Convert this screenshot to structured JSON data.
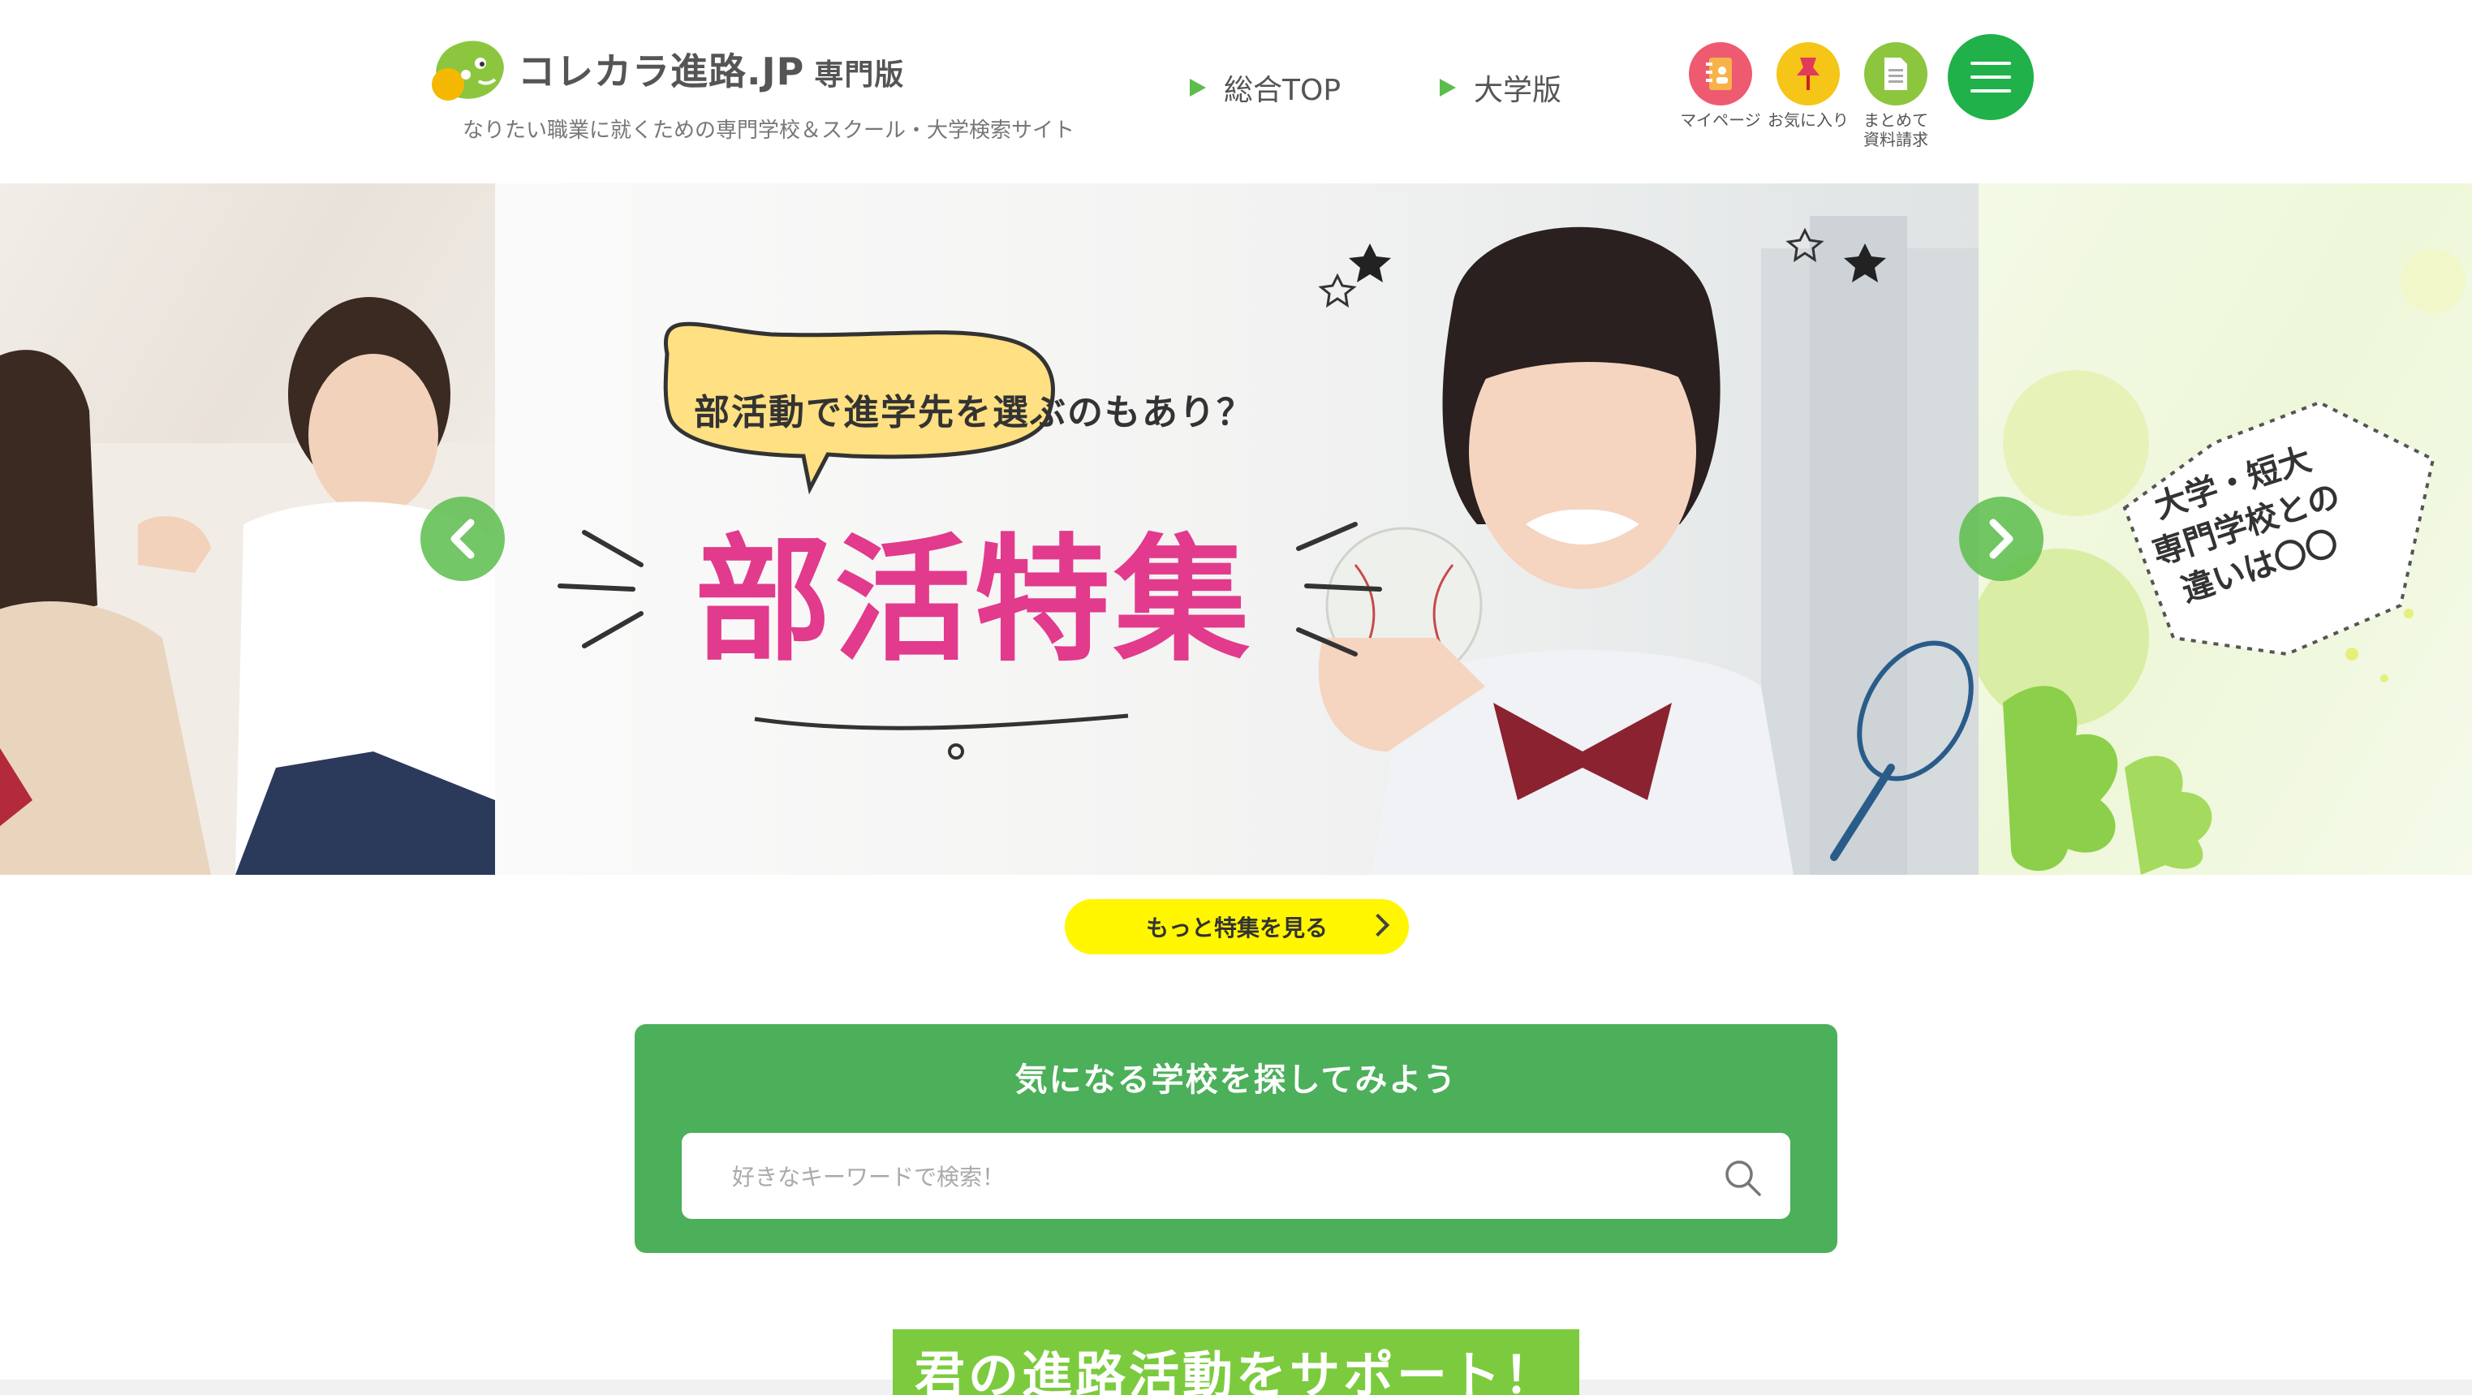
{
  "header": {
    "logo_main": "コレカラ進路.JP",
    "logo_sub": "専門版",
    "tagline": "なりたい職業に就くための専門学校＆スクール・大学検索サイト",
    "nav": [
      {
        "label": "総合TOP"
      },
      {
        "label": "大学版"
      }
    ],
    "icons": [
      {
        "label": "マイページ",
        "icon": "notebook-icon",
        "color": "#ee5a6f"
      },
      {
        "label": "お気に入り",
        "icon": "pin-icon",
        "color": "#f5c518"
      },
      {
        "label": "まとめて\n資料請求",
        "icon": "document-icon",
        "color": "#8cc63f"
      }
    ],
    "menu_icon": "hamburger-icon",
    "menu_color": "#20b14a"
  },
  "slider": {
    "bubble_text": "部活動で進学先を選ぶのもあり？",
    "feature_title": "部活特集",
    "right_slide_text": "大学・短大\n専門学校との\n違いは〇〇",
    "prev_icon": "chevron-left-icon",
    "next_icon": "chevron-right-icon"
  },
  "more_button": {
    "label": "もっと特集を見る",
    "color": "#fff600"
  },
  "search": {
    "title": "気になる学校を探してみよう",
    "placeholder": "好きなキーワードで検索！",
    "panel_color": "#4caf5a"
  },
  "support": {
    "text": "君の進路活動をサポート！",
    "color": "#7ccb3e"
  }
}
